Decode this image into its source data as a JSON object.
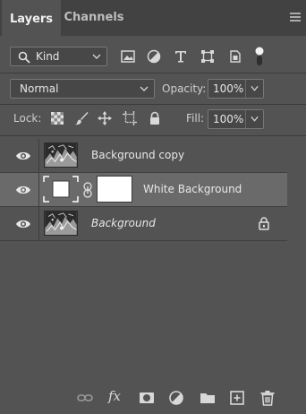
{
  "tabs": [
    {
      "label": "Layers"
    },
    {
      "label": "Channels"
    }
  ],
  "kind_filter": {
    "label": "Kind"
  },
  "blend_mode": {
    "label": "Normal"
  },
  "opacity": {
    "label": "Opacity:",
    "value": "100%"
  },
  "lock": {
    "label": "Lock:"
  },
  "fill": {
    "label": "Fill:",
    "value": "100%"
  },
  "layers": [
    {
      "name": "Background copy",
      "visible": true,
      "selected": false,
      "type": "image"
    },
    {
      "name": "White Background",
      "visible": true,
      "selected": true,
      "type": "mask"
    },
    {
      "name": "Background",
      "visible": true,
      "selected": false,
      "type": "image",
      "locked": true,
      "italic": true
    }
  ],
  "bottom_toolbar": {
    "fx_label": "fx"
  },
  "colors": {
    "panel_bg": "#535353",
    "tabbar_bg": "#424242",
    "selected_row": "#6a6a6a"
  }
}
